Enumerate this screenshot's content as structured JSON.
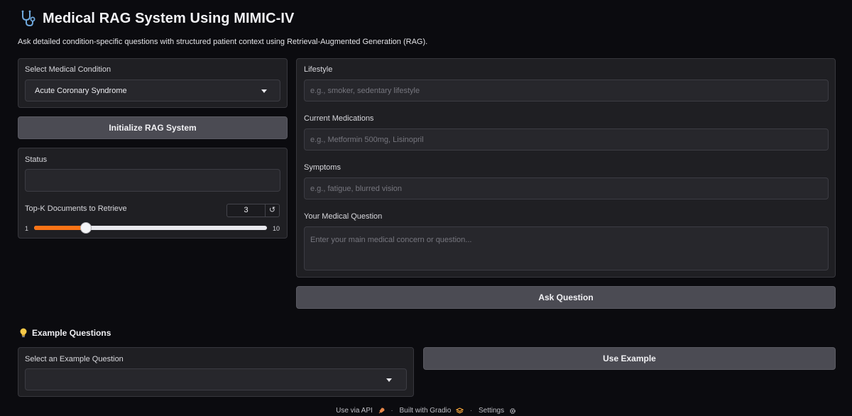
{
  "header": {
    "title": "Medical RAG System Using MIMIC-IV",
    "title_icon": "stethoscope-icon",
    "subtitle": "Ask detailed condition-specific questions with structured patient context using Retrieval-Augmented Generation (RAG)."
  },
  "left": {
    "condition_label": "Select Medical Condition",
    "condition_value": "Acute Coronary Syndrome",
    "init_button": "Initialize RAG System",
    "status_label": "Status",
    "status_value": "",
    "topk_label": "Top-K Documents to Retrieve",
    "topk_value": "3",
    "topk_min": "1",
    "topk_max": "10",
    "reset_icon": "reset-icon"
  },
  "right": {
    "lifestyle_label": "Lifestyle",
    "lifestyle_placeholder": "e.g., smoker, sedentary lifestyle",
    "medications_label": "Current Medications",
    "medications_placeholder": "e.g., Metformin 500mg, Lisinopril",
    "symptoms_label": "Symptoms",
    "symptoms_placeholder": "e.g., fatigue, blurred vision",
    "question_label": "Your Medical Question",
    "question_placeholder": "Enter your main medical concern or question...",
    "ask_button": "Ask Question"
  },
  "examples": {
    "section_title": "Example Questions",
    "section_icon": "lightbulb-icon",
    "select_label": "Select an Example Question",
    "select_value": "",
    "use_button": "Use Example"
  },
  "footer": {
    "api": "Use via API",
    "built": "Built with Gradio",
    "settings": "Settings"
  },
  "colors": {
    "accent": "#f97316",
    "background": "#0b0b0f",
    "panel": "#1f1f23",
    "button": "#4b4b53"
  }
}
